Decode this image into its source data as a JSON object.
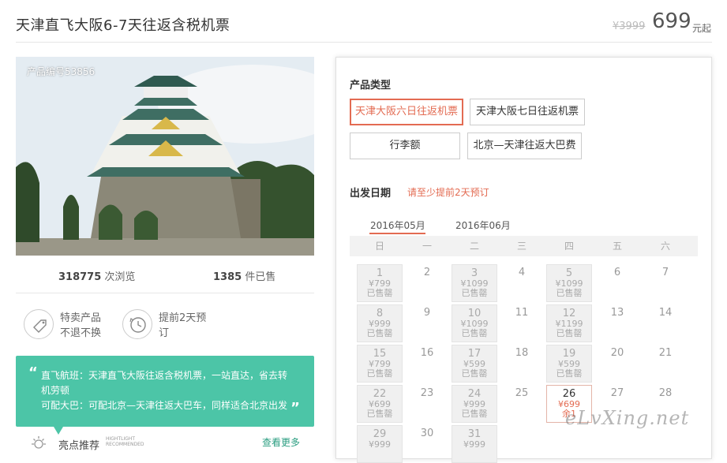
{
  "header": {
    "title": "天津直飞大阪6-7天往返含税机票",
    "orig_price": "¥3999",
    "price": "699",
    "price_unit": "元起"
  },
  "photo": {
    "product_id": "产品编号53856"
  },
  "stats": {
    "views_num": "318775",
    "views_label": "次浏览",
    "sold_num": "1385",
    "sold_label": "件已售"
  },
  "features": [
    {
      "icon": "tag-icon",
      "line1": "特卖产品",
      "line2": "不退不换"
    },
    {
      "icon": "clock-icon",
      "line1": "提前2天预",
      "line2": "订"
    }
  ],
  "intro": {
    "line1": "直飞航班：天津直飞大阪往返含税机票，一站直达，省去转",
    "line2": "机劳顿",
    "line3": "可配大巴：可配北京—天津往返大巴车，同样适合北京出发"
  },
  "highlight": {
    "label": "亮点推荐",
    "en1": "HIGHTLIGHT",
    "en2": "RECOMMENDED",
    "more": "查看更多"
  },
  "product_type": {
    "title": "产品类型",
    "options": [
      "天津大阪六日往返机票",
      "天津大阪七日往返机票",
      "行李额",
      "北京—天津往返大巴费"
    ],
    "selected": 0
  },
  "departure": {
    "title": "出发日期",
    "note": "请至少提前2天预订",
    "months": [
      "2016年05月",
      "2016年06月"
    ],
    "active_month": 0,
    "weekdays": [
      "日",
      "一",
      "二",
      "三",
      "四",
      "五",
      "六"
    ],
    "days": [
      [
        {
          "d": "1",
          "p": "¥799",
          "s": "已售罄"
        },
        {
          "d": "2"
        },
        {
          "d": "3",
          "p": "¥1099",
          "s": "已售罄"
        },
        {
          "d": "4"
        },
        {
          "d": "5",
          "p": "¥1099",
          "s": "已售罄"
        },
        {
          "d": "6"
        },
        {
          "d": "7"
        }
      ],
      [
        {
          "d": "8",
          "p": "¥999",
          "s": "已售罄"
        },
        {
          "d": "9"
        },
        {
          "d": "10",
          "p": "¥1099",
          "s": "已售罄"
        },
        {
          "d": "11"
        },
        {
          "d": "12",
          "p": "¥1199",
          "s": "已售罄"
        },
        {
          "d": "13"
        },
        {
          "d": "14"
        }
      ],
      [
        {
          "d": "15",
          "p": "¥799",
          "s": "已售罄"
        },
        {
          "d": "16"
        },
        {
          "d": "17",
          "p": "¥599",
          "s": "已售罄"
        },
        {
          "d": "18"
        },
        {
          "d": "19",
          "p": "¥599",
          "s": "已售罄"
        },
        {
          "d": "20"
        },
        {
          "d": "21"
        }
      ],
      [
        {
          "d": "22",
          "p": "¥699",
          "s": "已售罄"
        },
        {
          "d": "23"
        },
        {
          "d": "24",
          "p": "¥999",
          "s": "已售罄"
        },
        {
          "d": "25"
        },
        {
          "d": "26",
          "p": "¥699",
          "s": "余1",
          "avail": true
        },
        {
          "d": "27"
        },
        {
          "d": "28"
        }
      ],
      [
        {
          "d": "29",
          "p": "¥999",
          "s": ""
        },
        {
          "d": "30"
        },
        {
          "d": "31",
          "p": "¥999",
          "s": ""
        }
      ]
    ]
  },
  "watermark": "eLvXing.net",
  "colors": {
    "accent": "#e36b52",
    "green": "#4cc5a7"
  }
}
